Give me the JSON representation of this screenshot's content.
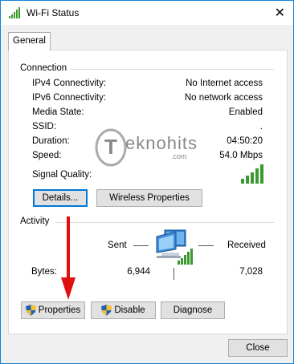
{
  "window": {
    "title": "Wi-Fi Status"
  },
  "tabs": [
    {
      "label": "General"
    }
  ],
  "connection": {
    "heading": "Connection",
    "rows": [
      {
        "label": "IPv4 Connectivity:",
        "value": "No Internet access"
      },
      {
        "label": "IPv6 Connectivity:",
        "value": "No network access"
      },
      {
        "label": "Media State:",
        "value": "Enabled"
      },
      {
        "label": "SSID:",
        "value": "."
      },
      {
        "label": "Duration:",
        "value": "04:50:20"
      },
      {
        "label": "Speed:",
        "value": "54.0 Mbps"
      }
    ],
    "signal_label": "Signal Quality:",
    "signal_bars_filled": 5,
    "signal_bars_total": 5,
    "details_button": "Details...",
    "wireless_button": "Wireless Properties"
  },
  "activity": {
    "heading": "Activity",
    "sent_label": "Sent",
    "received_label": "Received",
    "bytes_label": "Bytes:",
    "bytes_sent": "6,944",
    "bytes_received": "7,028"
  },
  "actions": {
    "properties": "Properties",
    "disable": "Disable",
    "diagnose": "Diagnose"
  },
  "close_button": "Close",
  "watermark": {
    "main": "eknohits",
    "sub": ".com",
    "initial": "T"
  },
  "colors": {
    "accent": "#0078d7",
    "signal_green": "#3a9a2f",
    "arrow_red": "#e01010",
    "border_blue": "#1883d7"
  }
}
